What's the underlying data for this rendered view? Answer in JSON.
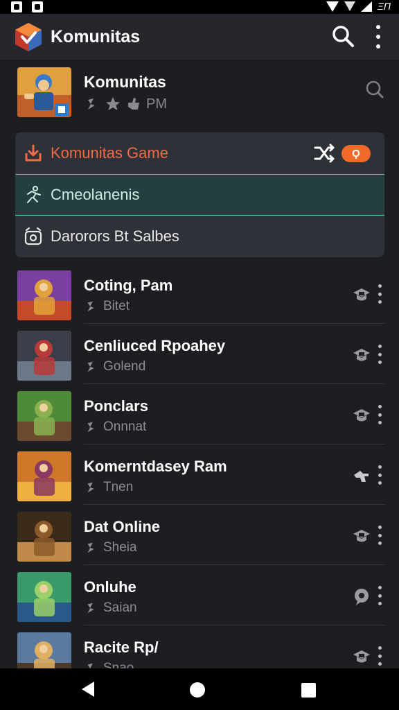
{
  "status_bar": {
    "time": "ΞΠ",
    "icons": [
      "notification-icon",
      "app-notification-icon",
      "wifi-icon",
      "data-icon",
      "signal-icon"
    ]
  },
  "app_bar": {
    "title": "Komunitas",
    "icons": [
      "app-logo-icon",
      "search-icon",
      "more-vert-icon"
    ]
  },
  "header": {
    "name": "Komunitas",
    "meta_text": "PM",
    "meta_icons": [
      "gamepad-icon",
      "star-icon",
      "thumbs-icon"
    ]
  },
  "menu": {
    "items": [
      {
        "label": "Komunitas Game",
        "icon": "download-icon",
        "color": "#f06a45",
        "badge": "Ϙ"
      },
      {
        "label": "Cmeolanenis",
        "icon": "runner-icon",
        "color": "#cfeee9",
        "selected": true
      },
      {
        "label": "Darorors Bt Salbes",
        "icon": "alarm-icon",
        "color": "#e8e8ea"
      }
    ]
  },
  "games": [
    {
      "title": "Coting, Pam",
      "subtitle": "Bitet",
      "action_icon": "graduation-cap-icon",
      "thumb_colors": [
        "#7a3fa0",
        "#e0a23a",
        "#c64a2a"
      ]
    },
    {
      "title": "Cenliuced Rpoahey",
      "subtitle": "Golend",
      "action_icon": "graduation-cap-icon",
      "thumb_colors": [
        "#3a3e48",
        "#b83a3a",
        "#6a7888"
      ]
    },
    {
      "title": "Ponclars",
      "subtitle": "Onnnat",
      "action_icon": "graduation-cap-icon",
      "thumb_colors": [
        "#4e8a3a",
        "#8ab050",
        "#6a4a30"
      ]
    },
    {
      "title": "Komerntdasey Ram",
      "subtitle": "Tnen",
      "action_icon": "hand-point-icon",
      "thumb_colors": [
        "#d0782a",
        "#8a3a60",
        "#f0b040"
      ]
    },
    {
      "title": "Dat Online",
      "subtitle": "Sheia",
      "action_icon": "graduation-cap-icon",
      "thumb_colors": [
        "#3a2a1a",
        "#8a5a2a",
        "#c08a4a"
      ]
    },
    {
      "title": "Onluhe",
      "subtitle": "Saian",
      "action_icon": "chat-bubble-icon",
      "thumb_colors": [
        "#3a9a6a",
        "#9ad06a",
        "#2a5a8a"
      ]
    },
    {
      "title": "Racite Rp/",
      "subtitle": "Snao",
      "action_icon": "graduation-cap-icon",
      "thumb_colors": [
        "#5a7aa0",
        "#e0b060",
        "#4a3a2a"
      ]
    }
  ],
  "colors": {
    "background": "#1d1e22",
    "app_bar": "#26272d",
    "accent_orange": "#f26a2a",
    "accent_teal": "#58c7b6"
  }
}
